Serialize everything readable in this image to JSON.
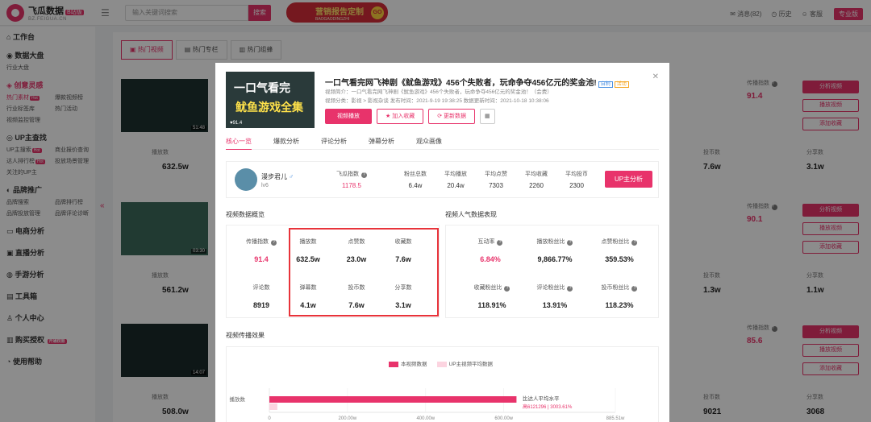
{
  "header": {
    "logo_name": "飞瓜数据",
    "logo_badge": "B站版",
    "logo_url": "BZ.FEIGUA.CN",
    "search_placeholder": "输入关键词搜索",
    "search_button": "搜索",
    "promo_title": "营销报告定制",
    "promo_sub": "BAOGAODINGZHI",
    "promo_go": "GO",
    "messages": "消息(82)",
    "history": "历史",
    "service": "客服",
    "pro": "专业版"
  },
  "sidebar": {
    "sections": [
      {
        "title": "工作台",
        "items": []
      },
      {
        "title": "数据大盘",
        "items": [
          "行业大盘"
        ]
      },
      {
        "title": "创意灵感",
        "items": [
          "热门素材",
          "爆款视频榜",
          "行业标签库",
          "热门活动",
          "视频监控管理"
        ]
      },
      {
        "title": "UP主查找",
        "items": [
          "UP主搜索",
          "商业报价查询",
          "达人排行榜",
          "投放场景管理",
          "关注的UP主"
        ]
      },
      {
        "title": "品牌推广",
        "items": [
          "品牌搜索",
          "品牌排行榜",
          "品牌投放管理",
          "品牌评论诊断"
        ]
      },
      {
        "title": "电商分析",
        "items": []
      },
      {
        "title": "直播分析",
        "items": []
      },
      {
        "title": "手游分析",
        "items": []
      },
      {
        "title": "工具箱",
        "items": []
      },
      {
        "title": "个人中心",
        "items": []
      },
      {
        "title": "购买授权",
        "items": []
      },
      {
        "title": "使用帮助",
        "items": []
      }
    ],
    "hot": "Hot",
    "buy_badge": "开通权限"
  },
  "main": {
    "tabs": [
      "热门视频",
      "热门专栏",
      "热门组蜂"
    ],
    "rows": [
      {
        "duration": "51:48",
        "play_label": "播放数",
        "play": "632.5w",
        "index_label": "传播指数",
        "index": "91.4",
        "coins_label": "投币数",
        "coins": "7.6w",
        "share_label": "分享数",
        "share": "3.1w"
      },
      {
        "duration": "03:30",
        "play_label": "播放数",
        "play": "561.2w",
        "index_label": "传播指数",
        "index": "90.1",
        "coins_label": "投币数",
        "coins": "1.3w",
        "share_label": "分享数",
        "share": "1.1w"
      },
      {
        "duration": "14:07",
        "play_label": "播放数",
        "play": "508.0w",
        "index_label": "传播指数",
        "index": "85.6",
        "coins_label": "投币数",
        "coins": "9021",
        "share_label": "分享数",
        "share": "3068"
      }
    ],
    "actions": [
      "分析视频",
      "播放视频",
      "添加收藏"
    ]
  },
  "modal": {
    "thumb_line1": "一口气看完",
    "thumb_line2": "鱿鱼游戏全集",
    "thumb_score": "91.4",
    "title": "一口气看完网飞神剧《鱿鱼游戏》456个失败者，玩命争夺456亿元的奖金池!",
    "tag1": "自制",
    "tag2": "活动",
    "desc": "视频简介：一口气看完网飞神剧《鱿鱼游戏》456个失败者，玩命争夺456亿元的奖金池！（会费）",
    "meta": "视频分类：影视 > 影视杂谈   发布时间：2021-9-19 19:38:25   数据更新时间：2021-10-18 10:38:06",
    "btn_play": "视频播放",
    "btn_fav": "加入收藏",
    "btn_update": "更新数据",
    "tabs": [
      "核心一览",
      "爆款分析",
      "评论分析",
      "弹幕分析",
      "观众画像"
    ],
    "up": {
      "name": "漫步君儿",
      "gender": "♂",
      "level": "lv6",
      "index_label": "飞瓜指数",
      "index": "1178.5",
      "fans_label": "粉丝总数",
      "fans": "6.4w",
      "avg_play_label": "平均播放",
      "avg_play": "20.4w",
      "avg_like_label": "平均点赞",
      "avg_like": "7303",
      "avg_fav_label": "平均收藏",
      "avg_fav": "2260",
      "avg_coin_label": "平均投币",
      "avg_coin": "2300",
      "button": "UP主分析"
    },
    "overview_title": "视频数据概览",
    "overview": [
      {
        "label": "传播指数",
        "value": "91.4"
      },
      {
        "label": "播放数",
        "value": "632.5w"
      },
      {
        "label": "点赞数",
        "value": "23.0w"
      },
      {
        "label": "收藏数",
        "value": "7.6w"
      },
      {
        "label": "评论数",
        "value": "8919"
      },
      {
        "label": "弹幕数",
        "value": "4.1w"
      },
      {
        "label": "投币数",
        "value": "7.6w"
      },
      {
        "label": "分享数",
        "value": "3.1w"
      }
    ],
    "popularity_title": "视频人气数据表现",
    "popularity": [
      {
        "label": "互动率",
        "value": "6.84%"
      },
      {
        "label": "播放粉丝比",
        "value": "9,866.77%"
      },
      {
        "label": "点赞粉丝比",
        "value": "359.53%"
      },
      {
        "label": "收藏粉丝比",
        "value": "118.91%"
      },
      {
        "label": "评论粉丝比",
        "value": "13.91%"
      },
      {
        "label": "投币粉丝比",
        "value": "118.23%"
      }
    ],
    "effect_title": "视频传播效果",
    "legend_this": "本视频数据",
    "legend_up": "UP主视频平均数据",
    "axis_label": "播放数",
    "ticks": [
      "0",
      "200.00w",
      "400.00w",
      "600.00w",
      "885.51w"
    ],
    "note1": "比达人平均水平",
    "note2": "高6121296 | 3003.61%",
    "colors": {
      "accent": "#e8336b",
      "accent_light": "#fcd4e0"
    }
  },
  "chart_data": {
    "type": "bar",
    "categories": [
      "播放数"
    ],
    "series": [
      {
        "name": "本视频数据",
        "values": [
          632.5
        ]
      },
      {
        "name": "UP主视频平均数据",
        "values": [
          20.4
        ]
      }
    ],
    "ylim": [
      0,
      885.51
    ]
  }
}
